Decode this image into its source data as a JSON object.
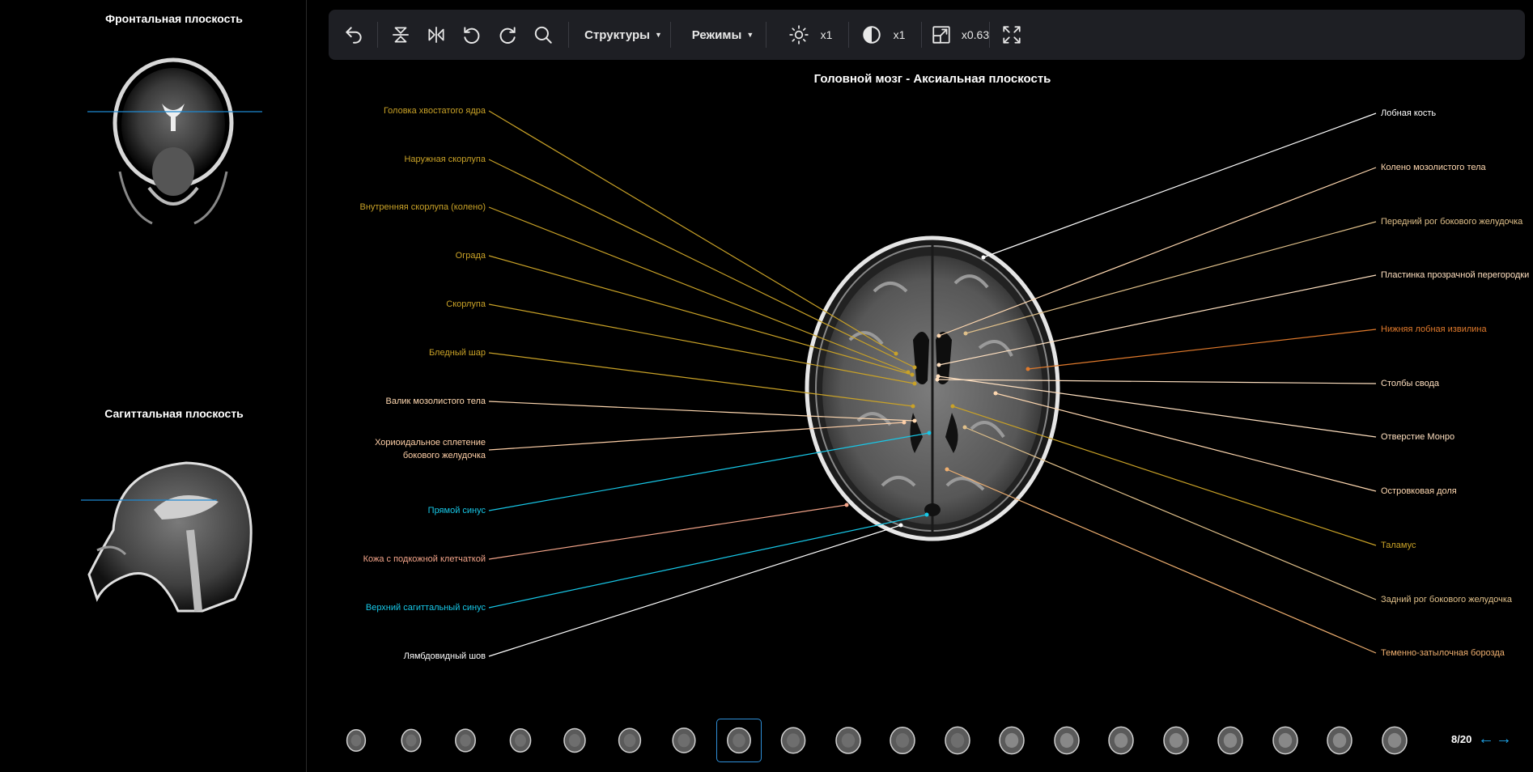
{
  "sidebar": {
    "frontal_title": "Фронтальная плоскость",
    "sagittal_title": "Сагиттальная плоскость"
  },
  "toolbar": {
    "structures_label": "Структуры",
    "modes_label": "Режимы",
    "brightness_value": "x1",
    "contrast_value": "x1",
    "zoom_value": "x0.63",
    "icons": [
      "undo-icon",
      "flip-vertical-icon",
      "flip-horizontal-icon",
      "rotate-left-icon",
      "rotate-right-icon",
      "search-icon",
      "brightness-icon",
      "contrast-icon",
      "zoom-scale-icon",
      "fullscreen-icon"
    ]
  },
  "viewer": {
    "title": "Головной мозг - Аксиальная плоскость"
  },
  "labels_left": [
    {
      "text": "Головка хвостатого ядра",
      "color": "#c9a227"
    },
    {
      "text": "Наружная скорлупа",
      "color": "#c9a227"
    },
    {
      "text": "Внутренняя скорлупа (колено)",
      "color": "#c9a227"
    },
    {
      "text": "Ограда",
      "color": "#c9a227"
    },
    {
      "text": "Скорлупа",
      "color": "#c9a227"
    },
    {
      "text": "Бледный шар",
      "color": "#c9a227"
    },
    {
      "text": "Валик мозолистого тела",
      "color": "#ffd8b0"
    },
    {
      "text": "Хориоидальное сплетение",
      "text2": "бокового желудочка",
      "color": "#ffd0a8"
    },
    {
      "text": "Прямой синус",
      "color": "#17c8e8"
    },
    {
      "text": "Кожа с подкожной клетчаткой",
      "color": "#f4a58a"
    },
    {
      "text": "Верхний сагиттальный синус",
      "color": "#17c8e8"
    },
    {
      "text": "Лямбдовидный шов",
      "color": "#ffffff"
    }
  ],
  "labels_right": [
    {
      "text": "Лобная кость",
      "color": "#ffffff"
    },
    {
      "text": "Колено мозолистого тела",
      "color": "#ffd8b0"
    },
    {
      "text": "Передний рог бокового желудочка",
      "color": "#e0c08a"
    },
    {
      "text": "Пластинка прозрачной перегородки",
      "color": "#ffe0c0"
    },
    {
      "text": "Нижняя лобная извилина",
      "color": "#e07a2c"
    },
    {
      "text": "Столбы свода",
      "color": "#ffe0c0"
    },
    {
      "text": "Отверстие Монро",
      "color": "#ffe0c0"
    },
    {
      "text": "Островковая доля",
      "color": "#ffd8b0"
    },
    {
      "text": "Таламус",
      "color": "#c9a227"
    },
    {
      "text": "Задний рог бокового желудочка",
      "color": "#e0c08a"
    },
    {
      "text": "Теменно-затылочная борозда",
      "color": "#f0b070"
    }
  ],
  "pager": {
    "text": "8/20",
    "current": 8,
    "total": 20
  }
}
